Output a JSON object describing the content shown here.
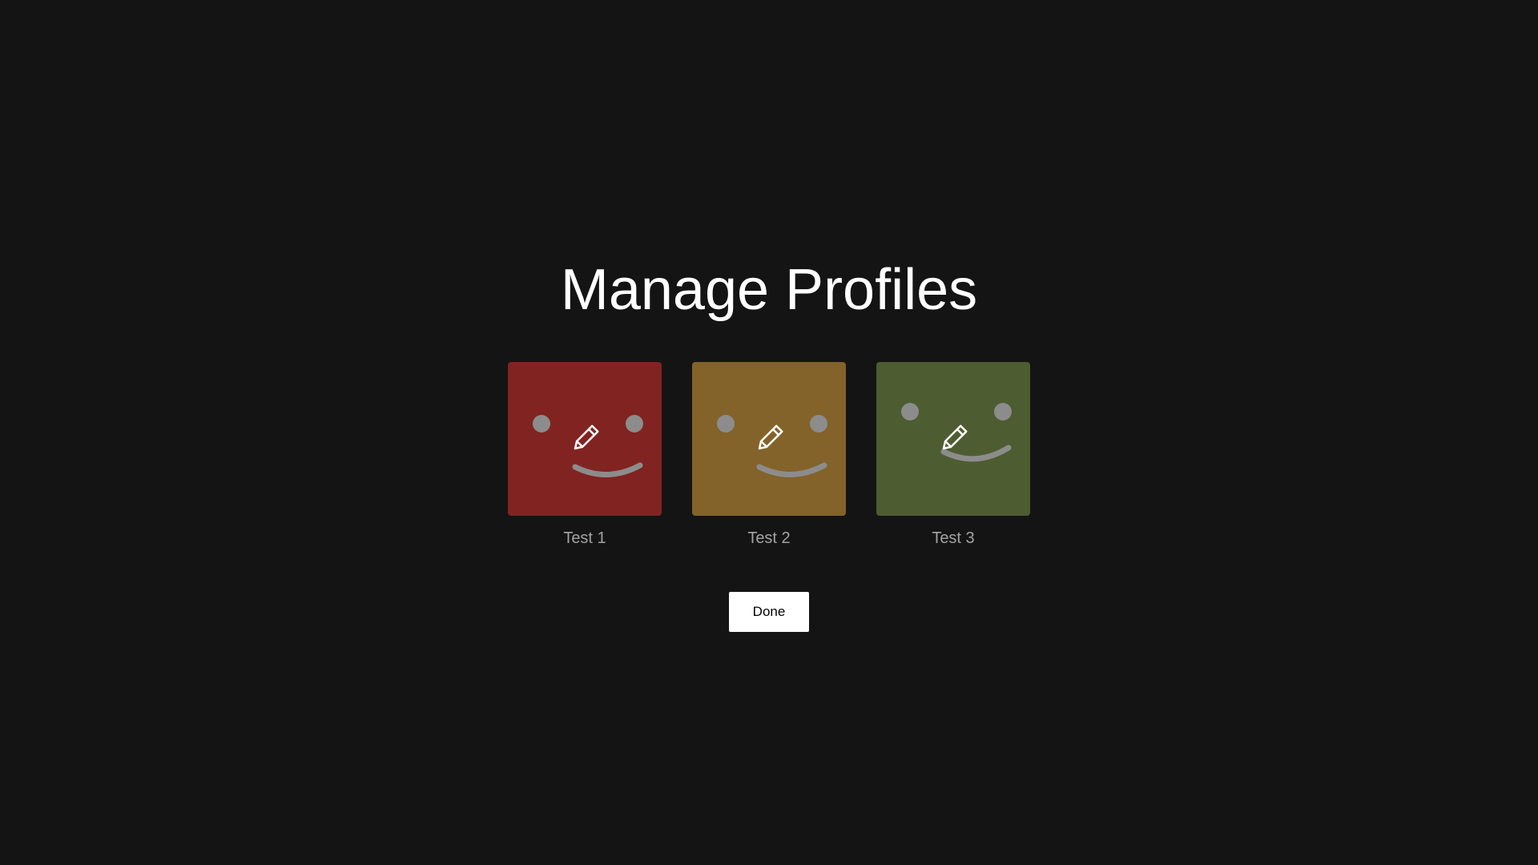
{
  "page": {
    "title": "Manage Profiles",
    "done_label": "Done"
  },
  "profiles": [
    {
      "name": "Test 1",
      "color": "#812321",
      "face": "smile-centered",
      "edit_icon": "pencil-icon"
    },
    {
      "name": "Test 2",
      "color": "#83632A",
      "face": "smile-centered",
      "edit_icon": "pencil-icon"
    },
    {
      "name": "Test 3",
      "color": "#4E5C31",
      "face": "smile-raised",
      "edit_icon": "pencil-icon"
    }
  ],
  "colors": {
    "background": "#141414",
    "title": "#ffffff",
    "profile_name": "#a3a3a3",
    "face_features": "#8c8c8c",
    "button_bg": "#ffffff",
    "button_text": "#000000"
  }
}
